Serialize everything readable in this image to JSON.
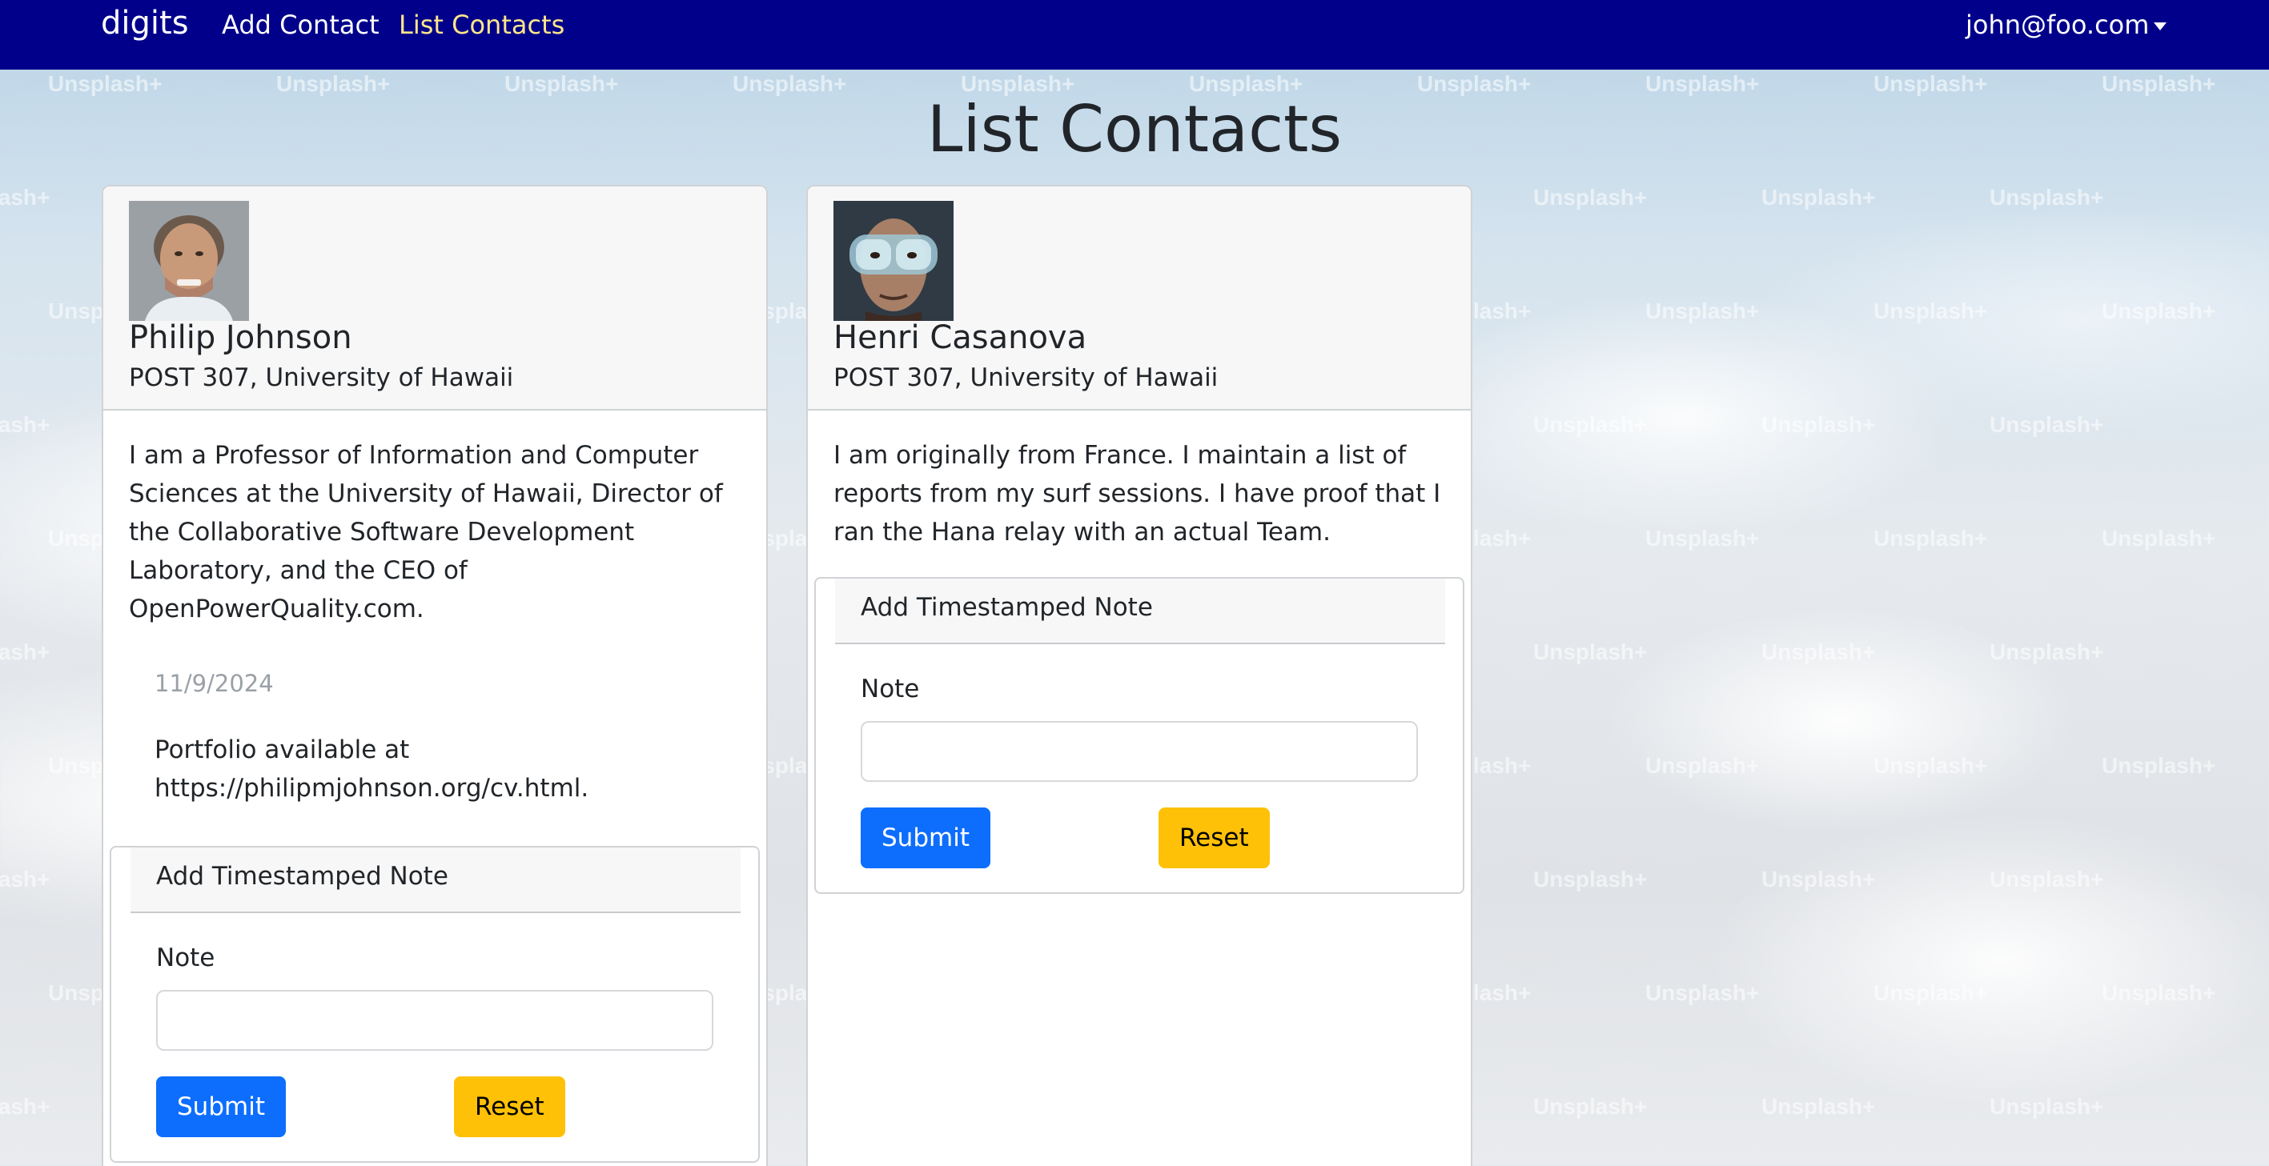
{
  "navbar": {
    "brand": "digits",
    "links": [
      {
        "label": "Add Contact"
      },
      {
        "label": "List Contacts"
      }
    ],
    "user": "john@foo.com",
    "active_link_color": "#fde68a",
    "background": "#00008b"
  },
  "page": {
    "title": "List Contacts",
    "watermark_text": "Unsplash+"
  },
  "contacts": [
    {
      "name": "Philip Johnson",
      "address": "POST 307, University of Hawaii",
      "description": "I am a Professor of Information and Computer Sciences at the University of Hawaii, Director of the Collaborative Software Development Laboratory, and the CEO of OpenPowerQuality.com.",
      "notes": [
        {
          "date": "11/9/2024",
          "text": "Portfolio available at https://philipmjohnson.org/cv.html."
        }
      ],
      "note_form": {
        "title": "Add Timestamped Note",
        "label": "Note",
        "value": "",
        "submit": "Submit",
        "reset": "Reset"
      }
    },
    {
      "name": "Henri Casanova",
      "address": "POST 307, University of Hawaii",
      "description": "I am originally from France. I maintain a list of reports from my surf sessions. I have proof that I ran the Hana relay with an actual Team.",
      "notes": [],
      "note_form": {
        "title": "Add Timestamped Note",
        "label": "Note",
        "value": "",
        "submit": "Submit",
        "reset": "Reset"
      }
    }
  ],
  "colors": {
    "submit": "#0d6efd",
    "reset": "#ffc107"
  }
}
